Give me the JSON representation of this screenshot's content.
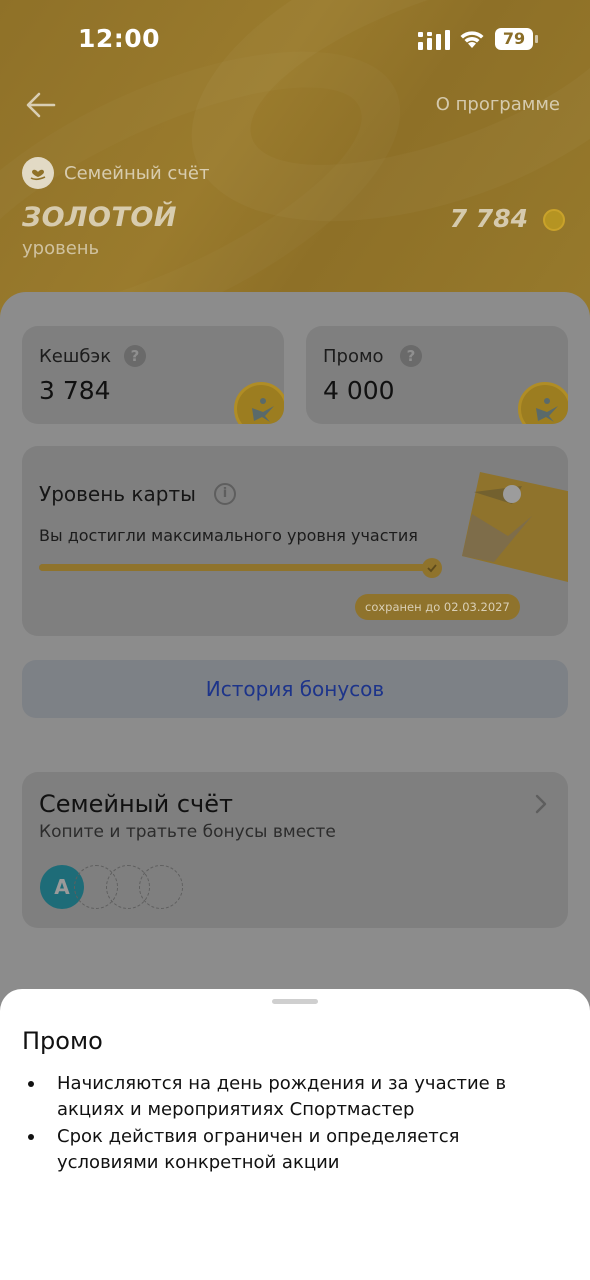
{
  "status_bar": {
    "time": "12:00",
    "battery": "79"
  },
  "header": {
    "about_label": "О программе",
    "account_label": "Семейный счёт",
    "level_name": "ЗОЛОТОЙ",
    "level_sub": "уровень",
    "points_total": "7 784"
  },
  "balances": {
    "cashback": {
      "label": "Кешбэк",
      "value": "3 784"
    },
    "promo": {
      "label": "Промо",
      "value": "4 000"
    }
  },
  "level_card": {
    "title": "Уровень карты",
    "description": "Вы достигли максимального уровня участия",
    "progress": 1.0,
    "saved_until": "сохранен до 02.03.2027"
  },
  "history_button": {
    "label": "История бонусов"
  },
  "family_card": {
    "title": "Семейный счёт",
    "subtitle": "Копите и тратьте бонусы вместе",
    "member_initial": "A"
  },
  "sheet": {
    "title": "Промо",
    "items": [
      "Начисляются на день рождения и за участие в акциях и мероприятиях Спортмастер",
      "Срок действия ограничен и определяется условиями конкретной акции"
    ]
  },
  "colors": {
    "accent_gold": "#C9A23A",
    "link_blue": "#1D3FA8"
  }
}
